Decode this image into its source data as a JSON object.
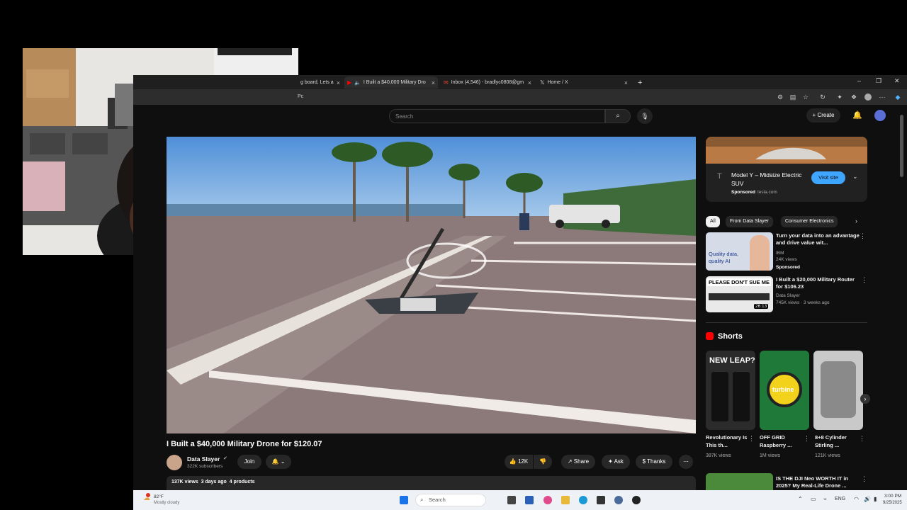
{
  "browser": {
    "tabs": [
      {
        "label": "g board, Lets a",
        "active": false
      },
      {
        "label": "I Built a $40,000 Military Dro",
        "active": true
      },
      {
        "label": "Inbox (4,546) - bradlyc0808@gm",
        "active": false
      },
      {
        "label": "Home / X",
        "active": false
      }
    ],
    "new_tab": "+",
    "address_fragment": "Pc"
  },
  "header": {
    "search_placeholder": "Search",
    "create_label": "Create"
  },
  "video": {
    "title": "I Built a $40,000 Military Drone for $120.07",
    "channel": "Data Slayer",
    "subscribers": "322K subscribers",
    "join_label": "Join",
    "likes": "12K",
    "share_label": "Share",
    "ask_label": "Ask",
    "thanks_label": "Thanks",
    "meta": "137K views  3 days ago  4 products"
  },
  "ad": {
    "title": "Model Y – Midsize Electric SUV",
    "sponsor": "Sponsored",
    "domain": "tesla.com",
    "cta": "Visit site"
  },
  "chips": [
    "All",
    "From Data Slayer",
    "Consumer Electronics"
  ],
  "recommendations": [
    {
      "title": "Turn your data into an advantage and drive value wit...",
      "channel": "IBM",
      "views": "24K views",
      "badge": "Sponsored",
      "thumb_text": "Quality data, quality AI"
    },
    {
      "title": "I Built a $20,000 Military Router for $106.23",
      "channel": "Data Slayer",
      "views": "745K views · 3 weeks ago",
      "duration": "26:13",
      "thumb_text": "PLEASE DON'T SUE ME"
    },
    {
      "title": "IS THE DJI Neo WORTH IT in 2025? My Real-Life Drone ..."
    }
  ],
  "shorts": {
    "heading": "Shorts",
    "items": [
      {
        "title": "Revolutionary Is This th...",
        "views": "387K views",
        "thumb_text": "NEW LEAP?"
      },
      {
        "title": "OFF GRID Raspberry ...",
        "views": "1M views",
        "thumb_text": "turbine"
      },
      {
        "title": "8+8 Cylinder Stirling ...",
        "views": "121K views",
        "thumb_text": ""
      }
    ]
  },
  "taskbar": {
    "weather_temp": "82°F",
    "weather_desc": "Mostly cloudy",
    "search_label": "Search",
    "lang": "ENG",
    "time": "3:00 PM",
    "date": "9/25/2025"
  },
  "colors": {
    "bg": "#0f0f0f",
    "accent_red": "#ff0000",
    "visit_btn": "#3ea6ff"
  }
}
